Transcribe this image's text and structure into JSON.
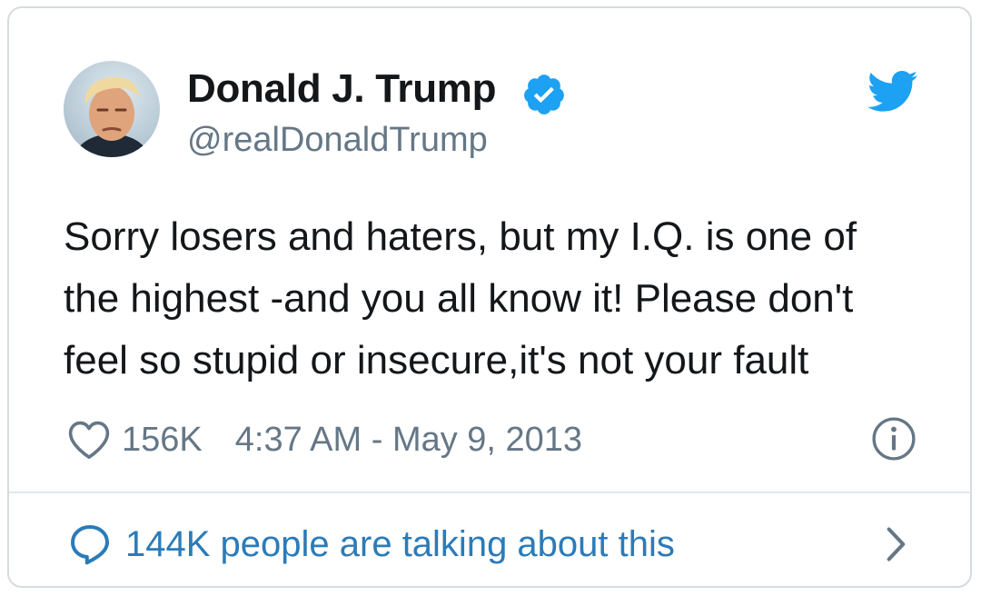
{
  "author": {
    "name": "Donald J. Trump",
    "handle": "@realDonaldTrump",
    "verified": true
  },
  "icons": {
    "avatar": "profile-photo",
    "verified": "verified-badge-icon",
    "brand": "twitter-bird-icon",
    "like": "heart-icon",
    "info": "info-icon",
    "conversation": "speech-bubble-icon",
    "more": "chevron-right-icon"
  },
  "tweet": {
    "lines": [
      "Sorry losers and haters, but my I.Q. is one of",
      "the highest -and you all know it! Please don't",
      "feel so stupid or insecure,it's not your fault"
    ],
    "likes": "156K",
    "timestamp": "4:37 AM - May 9, 2013"
  },
  "footer": {
    "talking_label": "144K people are talking about this"
  },
  "colors": {
    "brand_blue": "#1da1f2",
    "link_blue": "#2b7bb9",
    "muted_gray": "#657786",
    "text": "#14171a",
    "border": "#d6dbdf"
  }
}
